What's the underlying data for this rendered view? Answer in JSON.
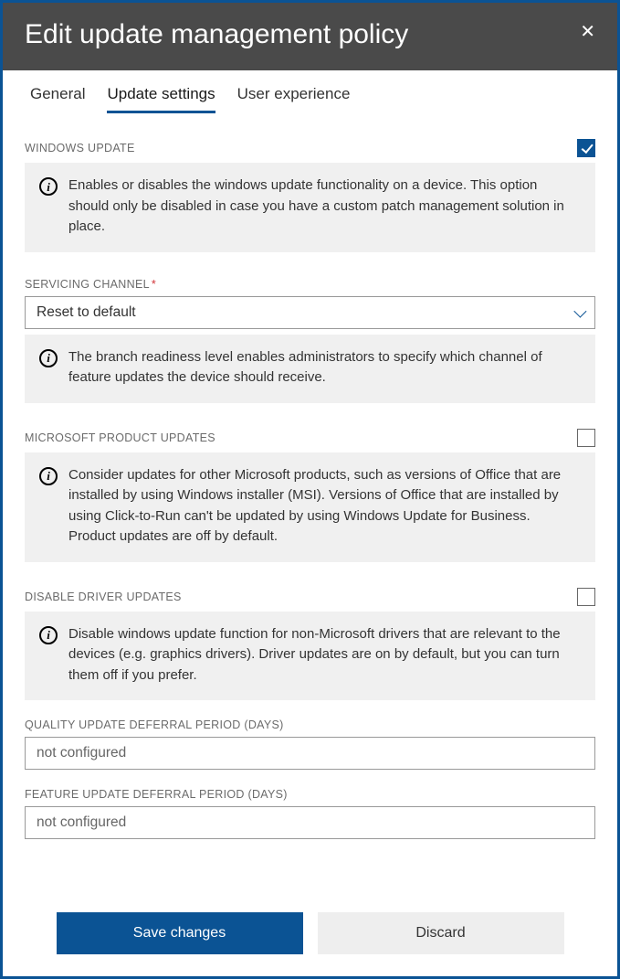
{
  "header": {
    "title": "Edit update management policy"
  },
  "tabs": [
    {
      "label": "General",
      "active": false
    },
    {
      "label": "Update settings",
      "active": true
    },
    {
      "label": "User experience",
      "active": false
    }
  ],
  "sections": {
    "windowsUpdate": {
      "label": "WINDOWS UPDATE",
      "checked": true,
      "info": "Enables or disables the windows update functionality on a device. This option should only be disabled in case you have a custom patch management solution in place."
    },
    "servicingChannel": {
      "label": "SERVICING CHANNEL",
      "required": true,
      "value": "Reset to default",
      "info": "The branch readiness level enables administrators to specify which channel of feature updates the device should receive."
    },
    "productUpdates": {
      "label": "MICROSOFT PRODUCT UPDATES",
      "checked": false,
      "info": "Consider updates for other Microsoft products, such as versions of Office that are installed by using Windows installer (MSI). Versions of Office that are installed by using Click-to-Run can't be updated by using Windows Update for Business. Product updates are off by default."
    },
    "driverUpdates": {
      "label": "DISABLE DRIVER UPDATES",
      "checked": false,
      "info": "Disable windows update function for non-Microsoft drivers that are relevant to the devices (e.g. graphics drivers). Driver updates are on by default, but you can turn them off if you prefer."
    },
    "qualityDeferral": {
      "label": "QUALITY UPDATE DEFERRAL PERIOD (DAYS)",
      "value": "not configured"
    },
    "featureDeferral": {
      "label": "FEATURE UPDATE DEFERRAL PERIOD (DAYS)",
      "value": "not configured"
    }
  },
  "footer": {
    "save": "Save changes",
    "discard": "Discard"
  }
}
